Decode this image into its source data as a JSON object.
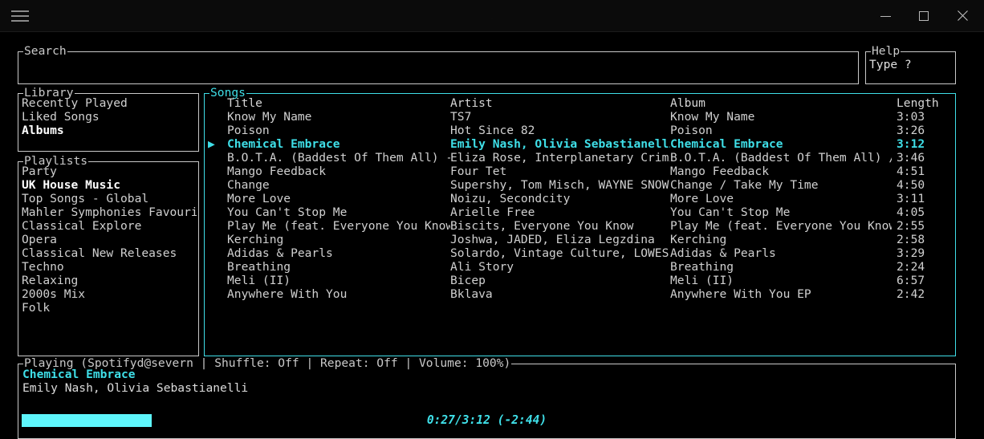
{
  "titlebar": {
    "title": ".",
    "menu_icon": "hamburger-icon",
    "minimize_label": "—",
    "maximize_label": "□",
    "close_label": "✕"
  },
  "search": {
    "label": "Search",
    "value": "",
    "placeholder": ""
  },
  "help": {
    "label": "Help",
    "text": "Type ?"
  },
  "library": {
    "label": "Library",
    "items": [
      {
        "label": "Recently Played",
        "selected": false
      },
      {
        "label": "Liked Songs",
        "selected": false
      },
      {
        "label": "Albums",
        "selected": true
      }
    ]
  },
  "playlists": {
    "label": "Playlists",
    "items": [
      {
        "label": "Party",
        "selected": false
      },
      {
        "label": "UK House Music",
        "selected": true
      },
      {
        "label": "Top Songs - Global",
        "selected": false
      },
      {
        "label": "Mahler Symphonies Favourite",
        "selected": false
      },
      {
        "label": "Classical Explore",
        "selected": false
      },
      {
        "label": "Opera",
        "selected": false
      },
      {
        "label": "Classical New Releases",
        "selected": false
      },
      {
        "label": "Techno",
        "selected": false
      },
      {
        "label": "Relaxing",
        "selected": false
      },
      {
        "label": "2000s Mix",
        "selected": false
      },
      {
        "label": "Folk",
        "selected": false
      }
    ]
  },
  "songs": {
    "label": "Songs",
    "focused": true,
    "columns": [
      "Title",
      "Artist",
      "Album",
      "Length"
    ],
    "playing_marker": "▶",
    "rows": [
      {
        "marker": "",
        "title": "Know My Name",
        "artist": "TS7",
        "album": "Know My Name",
        "length": "3:03",
        "playing": false
      },
      {
        "marker": "",
        "title": "Poison",
        "artist": "Hot Since 82",
        "album": "Poison",
        "length": "3:26",
        "playing": false
      },
      {
        "marker": "▶",
        "title": "Chemical Embrace",
        "artist": "Emily Nash, Olivia Sebastianelli",
        "album": "Chemical Embrace",
        "length": "3:12",
        "playing": true
      },
      {
        "marker": "",
        "title": "B.O.T.A. (Baddest Of Them All) - E",
        "artist": "Eliza Rose, Interplanetary Crimina",
        "album": "B.O.T.A. (Baddest Of Them All) / M",
        "length": "3:46",
        "playing": false
      },
      {
        "marker": "",
        "title": "Mango Feedback",
        "artist": "Four Tet",
        "album": "Mango Feedback",
        "length": "4:51",
        "playing": false
      },
      {
        "marker": "",
        "title": "Change",
        "artist": "Supershy, Tom Misch, WAYNE SNOW",
        "album": "Change / Take My Time",
        "length": "4:50",
        "playing": false
      },
      {
        "marker": "",
        "title": "More Love",
        "artist": "Noizu, Secondcity",
        "album": "More Love",
        "length": "3:11",
        "playing": false
      },
      {
        "marker": "",
        "title": "You Can't Stop Me",
        "artist": "Arielle Free",
        "album": "You Can't Stop Me",
        "length": "4:05",
        "playing": false
      },
      {
        "marker": "",
        "title": "Play Me (feat. Everyone You Know)",
        "artist": "Biscits, Everyone You Know",
        "album": "Play Me (feat. Everyone You Know)",
        "length": "2:55",
        "playing": false
      },
      {
        "marker": "",
        "title": "Kerching",
        "artist": "Joshwa, JADED, Eliza Legzdina",
        "album": "Kerching",
        "length": "2:58",
        "playing": false
      },
      {
        "marker": "",
        "title": "Adidas & Pearls",
        "artist": "Solardo, Vintage Culture, LOWES",
        "album": "Adidas & Pearls",
        "length": "3:29",
        "playing": false
      },
      {
        "marker": "",
        "title": "Breathing",
        "artist": "Ali Story",
        "album": "Breathing",
        "length": "2:24",
        "playing": false
      },
      {
        "marker": "",
        "title": "Meli (II)",
        "artist": "Bicep",
        "album": "Meli (II)",
        "length": "6:57",
        "playing": false
      },
      {
        "marker": "",
        "title": "Anywhere With You",
        "artist": "Bklava",
        "album": "Anywhere With You EP",
        "length": "2:42",
        "playing": false
      }
    ]
  },
  "playing": {
    "label": "Playing (Spotifyd@severn | Shuffle: Off | Repeat: Off   | Volume: 100%)",
    "device": "Spotifyd@severn",
    "shuffle": "Off",
    "repeat": "Off",
    "volume": "100%",
    "track_title": "Chemical Embrace",
    "track_artist": "Emily Nash, Olivia Sebastianelli",
    "elapsed": "0:27",
    "duration": "3:12",
    "remaining": "-2:44",
    "time_display": "0:27/3:12 (-2:44)",
    "progress_percent": 14
  },
  "colors": {
    "background": "#000000",
    "foreground": "#d0d0d0",
    "accent_cyan": "#3fdfe8",
    "progress_fill": "#5ef5fb",
    "border": "#c9c9c9",
    "selected_text": "#ffffff"
  }
}
